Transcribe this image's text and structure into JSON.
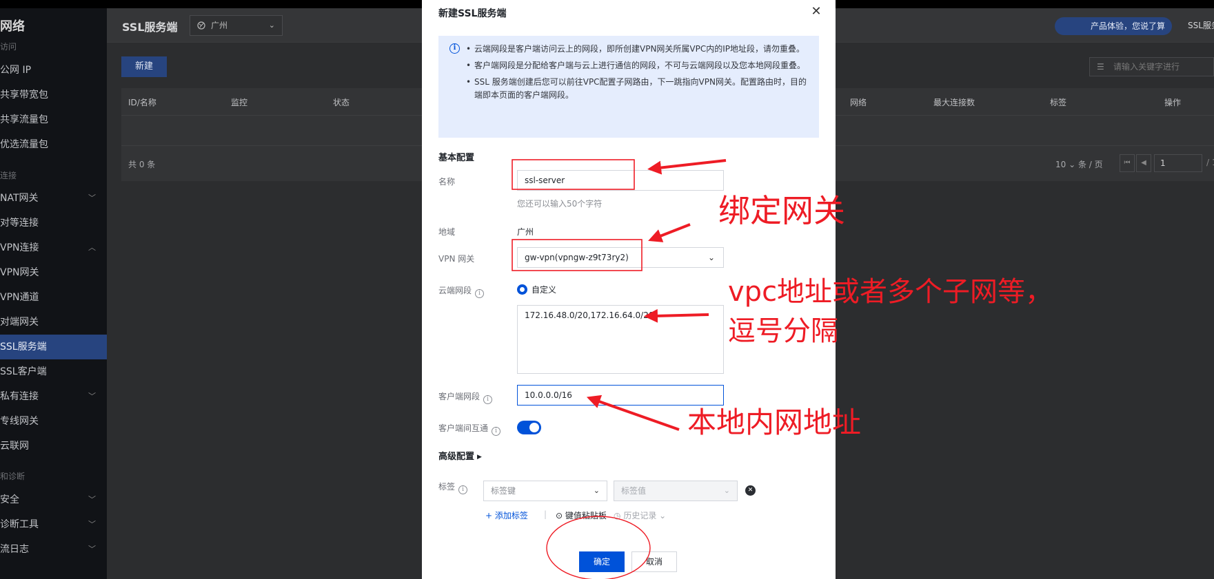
{
  "sidebar": {
    "title": "网络",
    "items": [
      {
        "label": "访问",
        "kind": "group"
      },
      {
        "label": "公网 IP",
        "kind": "item"
      },
      {
        "label": "共享带宽包",
        "kind": "item"
      },
      {
        "label": "共享流量包",
        "kind": "item"
      },
      {
        "label": "优选流量包",
        "kind": "item"
      },
      {
        "label": "连接",
        "kind": "group"
      },
      {
        "label": "NAT网关",
        "kind": "item",
        "chevron": "down"
      },
      {
        "label": "对等连接",
        "kind": "item"
      },
      {
        "label": "VPN连接",
        "kind": "item",
        "chevron": "up"
      },
      {
        "label": "VPN网关",
        "kind": "item"
      },
      {
        "label": "VPN通道",
        "kind": "item"
      },
      {
        "label": "对端网关",
        "kind": "item"
      },
      {
        "label": "SSL服务端",
        "kind": "item",
        "active": true
      },
      {
        "label": "SSL客户端",
        "kind": "item"
      },
      {
        "label": "私有连接",
        "kind": "item",
        "chevron": "down"
      },
      {
        "label": "专线网关",
        "kind": "item"
      },
      {
        "label": "云联网",
        "kind": "item"
      },
      {
        "label": "和诊断",
        "kind": "group"
      },
      {
        "label": "安全",
        "kind": "item",
        "chevron": "down"
      },
      {
        "label": "诊断工具",
        "kind": "item",
        "chevron": "down"
      },
      {
        "label": "流日志",
        "kind": "item",
        "chevron": "down"
      }
    ]
  },
  "header": {
    "page_title": "SSL服务端",
    "region": "广州",
    "promo": "产品体验，您说了算",
    "user": "SSL服务"
  },
  "toolbar": {
    "new_label": "新建",
    "search_placeholder": "请输入关键字进行"
  },
  "table": {
    "columns": [
      "ID/名称",
      "监控",
      "状态",
      "网络",
      "最大连接数",
      "标签",
      "操作"
    ],
    "total": "共 0 条",
    "page_size": "10",
    "page_size_unit": "条 / 页",
    "page": "1",
    "page_total": "/ 1"
  },
  "modal": {
    "title": "新建SSL服务端",
    "notice": [
      "云端网段是客户端访问云上的网段，即所创建VPN网关所属VPC内的IP地址段，请勿重叠。",
      "客户端网段是分配给客户端与云上进行通信的网段，不可与云端网段以及您本地网段重叠。",
      "SSL 服务端创建后您可以前往VPC配置子网路由，下一跳指向VPN网关。配置路由时，目的端即本页面的客户端网段。"
    ],
    "basic_section": "基本配置",
    "name_label": "名称",
    "name_value": "ssl-server",
    "name_hint": "您还可以输入50个字符",
    "region_label": "地域",
    "region_value": "广州",
    "gateway_label": "VPN 网关",
    "gateway_value": "gw-vpn(vpngw-z9t73ry2)",
    "cloud_cidr_label": "云端网段",
    "cloud_cidr_mode": "自定义",
    "cloud_cidr_value": "172.16.48.0/20,172.16.64.0/20",
    "client_cidr_label": "客户端网段",
    "client_cidr_value": "10.0.0.0/16",
    "interconnect_label": "客户端间互通",
    "interconnect_on": true,
    "advanced_section": "高级配置",
    "tags_label": "标签",
    "tag_key_placeholder": "标签键",
    "tag_value_placeholder": "标签值",
    "add_tag": "添加标签",
    "paste": "键值粘贴板",
    "history": "历史记录",
    "ok": "确定",
    "cancel": "取消"
  },
  "annotations": {
    "color": "#ee1c25",
    "bind_gateway": "绑定网关",
    "vpc_line1": "vpc地址或者多个子网等，",
    "vpc_line2": "逗号分隔",
    "local_net": "本地内网地址"
  },
  "colors": {
    "primary": "#0052d9",
    "notice_bg": "#e5edfd",
    "annotation": "#ee1c25"
  }
}
